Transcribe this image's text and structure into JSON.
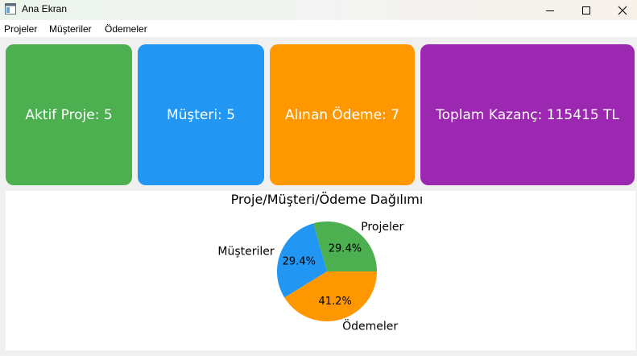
{
  "window": {
    "title": "Ana Ekran",
    "icon": "window-icon",
    "controls": [
      "minimize-icon",
      "maximize-icon",
      "close-icon"
    ]
  },
  "menu": {
    "items": [
      {
        "label": "Projeler"
      },
      {
        "label": "Müşteriler"
      },
      {
        "label": "Ödemeler"
      }
    ]
  },
  "cards": [
    {
      "label": "Aktif Proje: 5",
      "color": "#4caf50"
    },
    {
      "label": "Müşteri: 5",
      "color": "#2196f3"
    },
    {
      "label": "Alınan Ödeme: 7",
      "color": "#ff9800"
    },
    {
      "label": "Toplam Kazanç: 115415 TL",
      "color": "#9c27b0"
    }
  ],
  "chart_data": {
    "type": "pie",
    "title": "Proje/Müşteri/Ödeme Dağılımı",
    "categories": [
      "Projeler",
      "Müşteriler",
      "Ödemeler"
    ],
    "values": [
      29.4,
      29.4,
      41.2
    ],
    "labels": [
      "29.4%",
      "29.4%",
      "41.2%"
    ],
    "colors": [
      "#4caf50",
      "#2196f3",
      "#ff9800"
    ]
  }
}
